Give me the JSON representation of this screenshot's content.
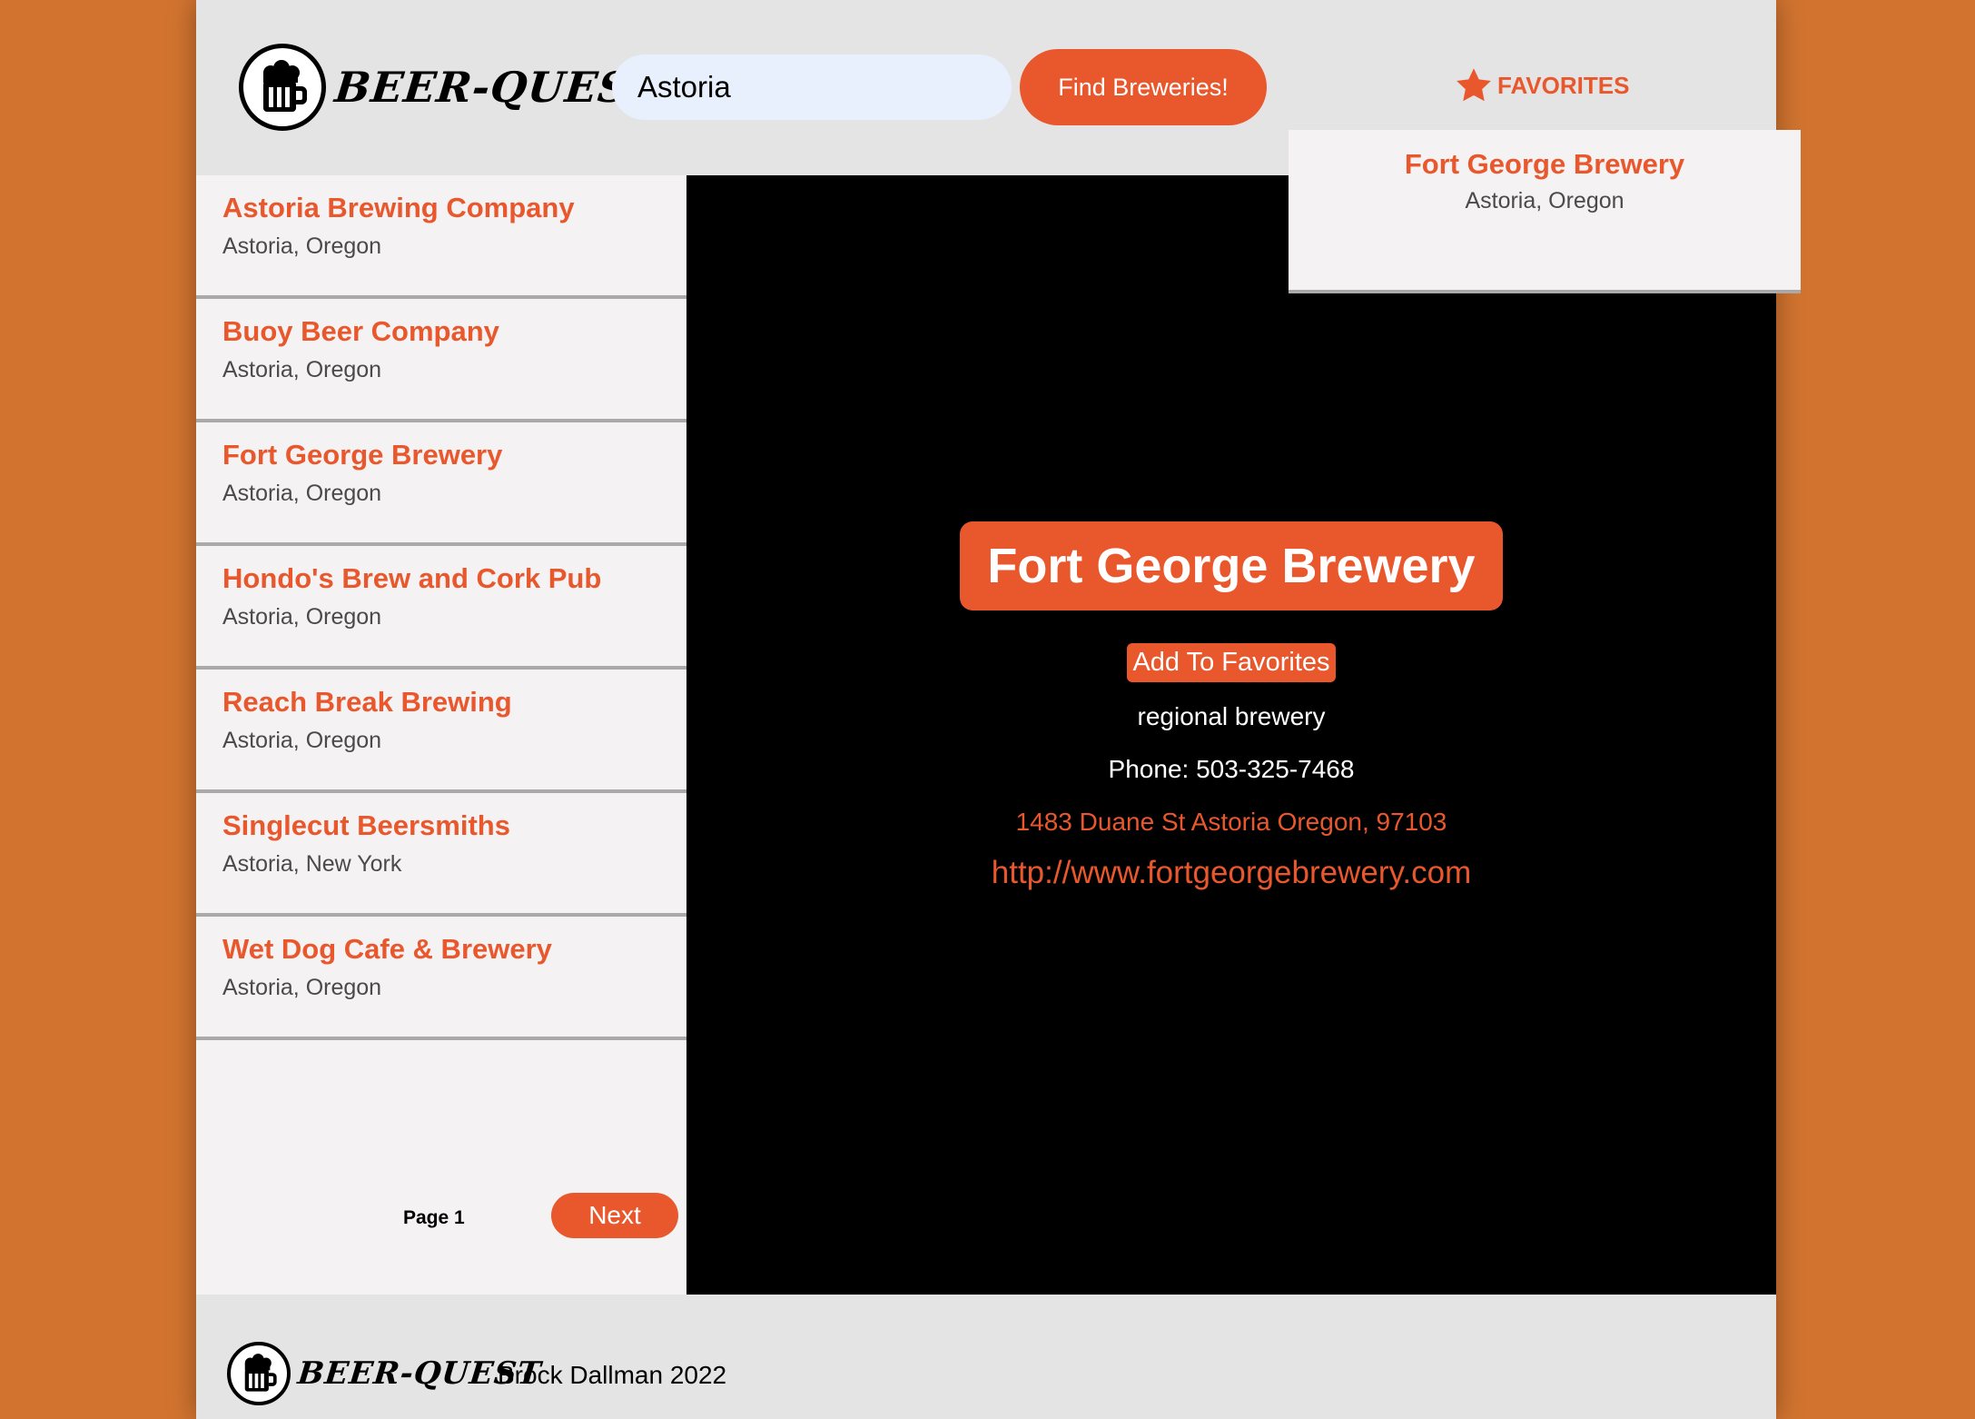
{
  "header": {
    "brand": "BEER-QUEST",
    "logo_icon": "beer-mug-icon",
    "search": {
      "value": "Astoria",
      "placeholder": ""
    },
    "find_button": "Find Breweries!",
    "favorites_label": "FAVORITES",
    "favorites_icon": "star-icon"
  },
  "favorites_panel": {
    "items": [
      {
        "name": "Fort George Brewery",
        "location": "Astoria, Oregon"
      }
    ]
  },
  "results": {
    "items": [
      {
        "name": "Astoria Brewing Company",
        "location": "Astoria, Oregon"
      },
      {
        "name": "Buoy Beer Company",
        "location": "Astoria, Oregon"
      },
      {
        "name": "Fort George Brewery",
        "location": "Astoria, Oregon"
      },
      {
        "name": "Hondo's Brew and Cork Pub",
        "location": "Astoria, Oregon"
      },
      {
        "name": "Reach Break Brewing",
        "location": "Astoria, Oregon"
      },
      {
        "name": "Singlecut Beersmiths",
        "location": "Astoria, New York"
      },
      {
        "name": "Wet Dog Cafe & Brewery",
        "location": "Astoria, Oregon"
      }
    ],
    "page_label": "Page 1",
    "next_button": "Next"
  },
  "detail": {
    "title": "Fort George Brewery",
    "add_favorite_button": "Add To Favorites",
    "type": "regional brewery",
    "phone": "Phone: 503-325-7468",
    "address": "1483 Duane St Astoria Oregon, 97103",
    "website": "http://www.fortgeorgebrewery.com"
  },
  "footer": {
    "brand": "BEER-QUEST",
    "credit": "Brock Dallman 2022"
  },
  "colors": {
    "background": "#d27430",
    "accent": "#e9572d",
    "panel": "#f4f2f2",
    "chrome": "#e4e4e4",
    "detail_bg": "#000000"
  }
}
